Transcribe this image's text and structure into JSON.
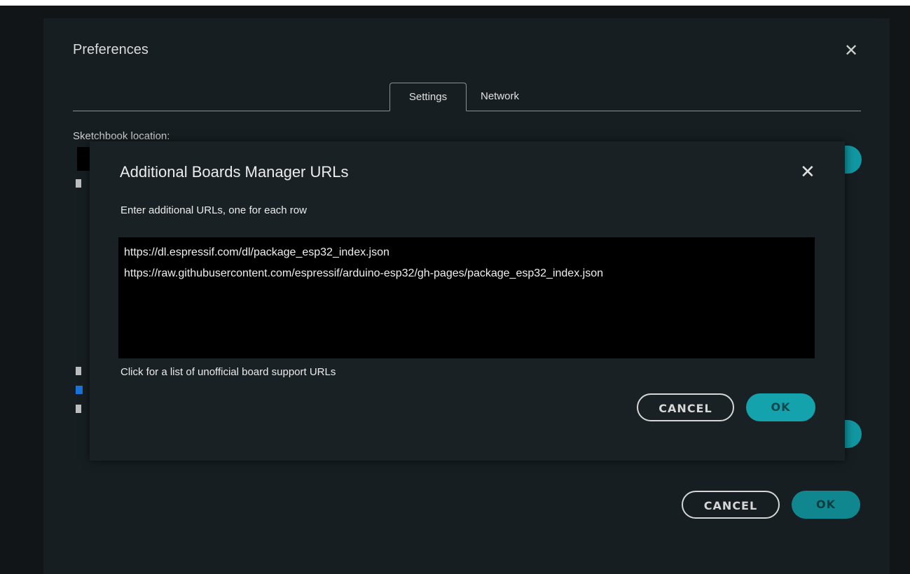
{
  "preferences": {
    "title": "Preferences",
    "tabs": [
      {
        "label": "Settings",
        "active": true
      },
      {
        "label": "Network",
        "active": false
      }
    ],
    "sketchbook_label": "Sketchbook location:",
    "cancel_label": "CANCEL",
    "ok_label": "OK"
  },
  "boards_dialog": {
    "title": "Additional Boards Manager URLs",
    "instructions": "Enter additional URLs, one for each row",
    "urls": [
      "https://dl.espressif.com/dl/package_esp32_index.json",
      "https://raw.githubusercontent.com/espressif/arduino-esp32/gh-pages/package_esp32_index.json"
    ],
    "link_text": "Click for a list of unofficial board support URLs",
    "cancel_label": "CANCEL",
    "ok_label": "OK"
  },
  "colors": {
    "accent": "#14a3ad",
    "dialog_bg": "#1a2125",
    "text_area_bg": "#000000"
  },
  "icons": {
    "close": "close-icon"
  }
}
